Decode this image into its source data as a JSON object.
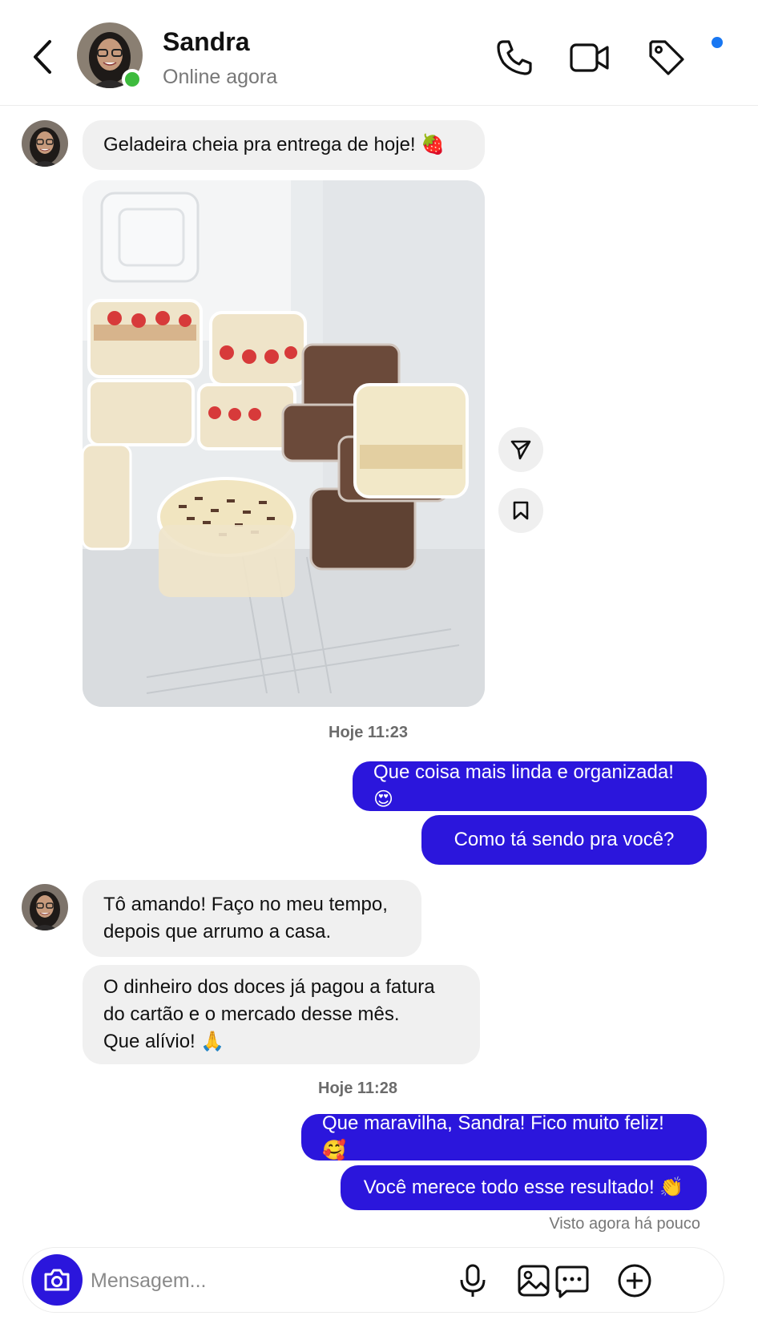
{
  "header": {
    "contact_name": "Sandra",
    "contact_status": "Online agora"
  },
  "messages": {
    "m1": "Geladeira cheia pra entrega de hoje! 🍓",
    "time1": "Hoje 11:23",
    "o1": "Que coisa mais linda e organizada! 😍",
    "o2": "Como tá sendo pra você?",
    "m2_line1": "Tô amando! Faço no meu tempo,",
    "m2_line2": "depois que arrumo a casa.",
    "m3_line1": "O dinheiro dos doces já pagou a fatura",
    "m3_line2": "do cartão e o mercado desse mês.",
    "m3_line3": "Que alívio! 🙏",
    "time2": "Hoje 11:28",
    "o3": "Que maravilha, Sandra! Fico muito feliz! 🥰",
    "o4": "Você merece todo esse resultado! 👏",
    "seen": "Visto agora há pouco"
  },
  "composer": {
    "placeholder": "Mensagem..."
  },
  "colors": {
    "accent": "#2b16dc",
    "incoming_bubble": "#f0f0f0",
    "online": "#3dbb3d",
    "notification_dot": "#1877f2"
  },
  "icons": [
    "back-arrow-icon",
    "phone-icon",
    "video-icon",
    "tag-icon",
    "send-icon",
    "bookmark-icon",
    "camera-icon",
    "microphone-icon",
    "gallery-icon",
    "chat-bubble-icon",
    "add-icon"
  ]
}
